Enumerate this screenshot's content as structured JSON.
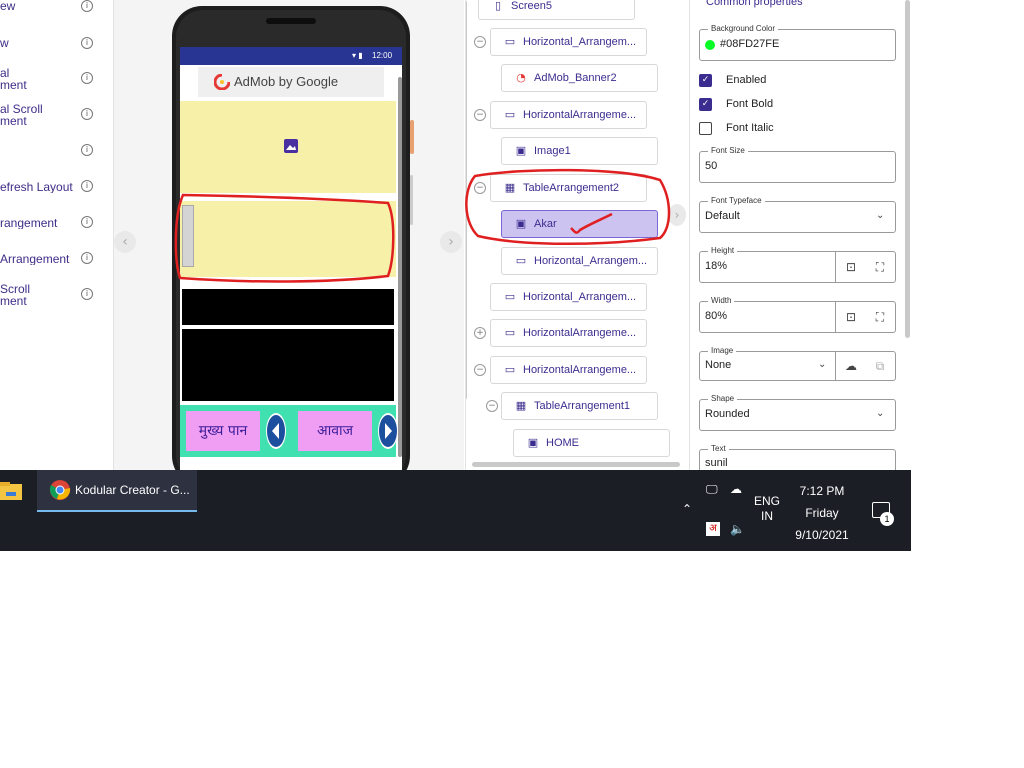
{
  "palette": {
    "items": [
      {
        "label": "ew"
      },
      {
        "label": "w"
      },
      {
        "label": "al\nment"
      },
      {
        "label": "al Scroll\nment"
      },
      {
        "label": ""
      },
      {
        "label": "efresh Layout"
      },
      {
        "label": "rangement"
      },
      {
        "label": "Arrangement"
      },
      {
        "label": "Scroll\nment"
      }
    ],
    "info_glyph": "i"
  },
  "viewer": {
    "status_time": "12:00",
    "ad_text": "AdMob by Google",
    "bottom_buttons": [
      "मुख्य पान",
      "आवाज"
    ]
  },
  "tree": {
    "nodes": [
      {
        "label": "Screen5",
        "icon": "phone-icon"
      },
      {
        "label": "Horizontal_Arrangem...",
        "icon": "horizontal-arrangement-icon"
      },
      {
        "label": "AdMob_Banner2",
        "icon": "admob-icon"
      },
      {
        "label": "HorizontalArrangeme...",
        "icon": "horizontal-arrangement-icon"
      },
      {
        "label": "Image1",
        "icon": "image-icon"
      },
      {
        "label": "TableArrangement2",
        "icon": "table-icon"
      },
      {
        "label": "Akar",
        "icon": "textbox-icon",
        "selected": true
      },
      {
        "label": "Horizontal_Arrangem...",
        "icon": "horizontal-arrangement-icon"
      },
      {
        "label": "Horizontal_Arrangem...",
        "icon": "horizontal-arrangement-icon"
      },
      {
        "label": "HorizontalArrangeme...",
        "icon": "horizontal-arrangement-icon"
      },
      {
        "label": "HorizontalArrangeme...",
        "icon": "horizontal-arrangement-icon"
      },
      {
        "label": "TableArrangement1",
        "icon": "table-icon"
      },
      {
        "label": "HOME",
        "icon": "button-icon"
      }
    ]
  },
  "props": {
    "header": "Common properties",
    "background_color": {
      "legend": "Background Color",
      "value": "#08FD27FE",
      "swatch": "#08fd27"
    },
    "enabled": {
      "label": "Enabled",
      "checked": true
    },
    "font_bold": {
      "label": "Font Bold",
      "checked": true
    },
    "font_italic": {
      "label": "Font Italic",
      "checked": false
    },
    "font_size": {
      "legend": "Font Size",
      "value": "50"
    },
    "font_typeface": {
      "legend": "Font Typeface",
      "value": "Default"
    },
    "height": {
      "legend": "Height",
      "value": "18%"
    },
    "width": {
      "legend": "Width",
      "value": "80%"
    },
    "image": {
      "legend": "Image",
      "value": "None"
    },
    "shape": {
      "legend": "Shape",
      "value": "Rounded"
    },
    "text": {
      "legend": "Text",
      "value": "sunil"
    }
  },
  "taskbar": {
    "app_label": "Kodular Creator - G...",
    "lang_line1": "ENG",
    "lang_line2": "IN",
    "time": "7:12 PM",
    "day": "Friday",
    "date": "9/10/2021",
    "notification_count": "1"
  },
  "colors": {
    "accent": "#3b2d8f",
    "selected_node": "#cdc3f0",
    "annotation": "#e02020",
    "taskbar": "#1c1e26"
  }
}
